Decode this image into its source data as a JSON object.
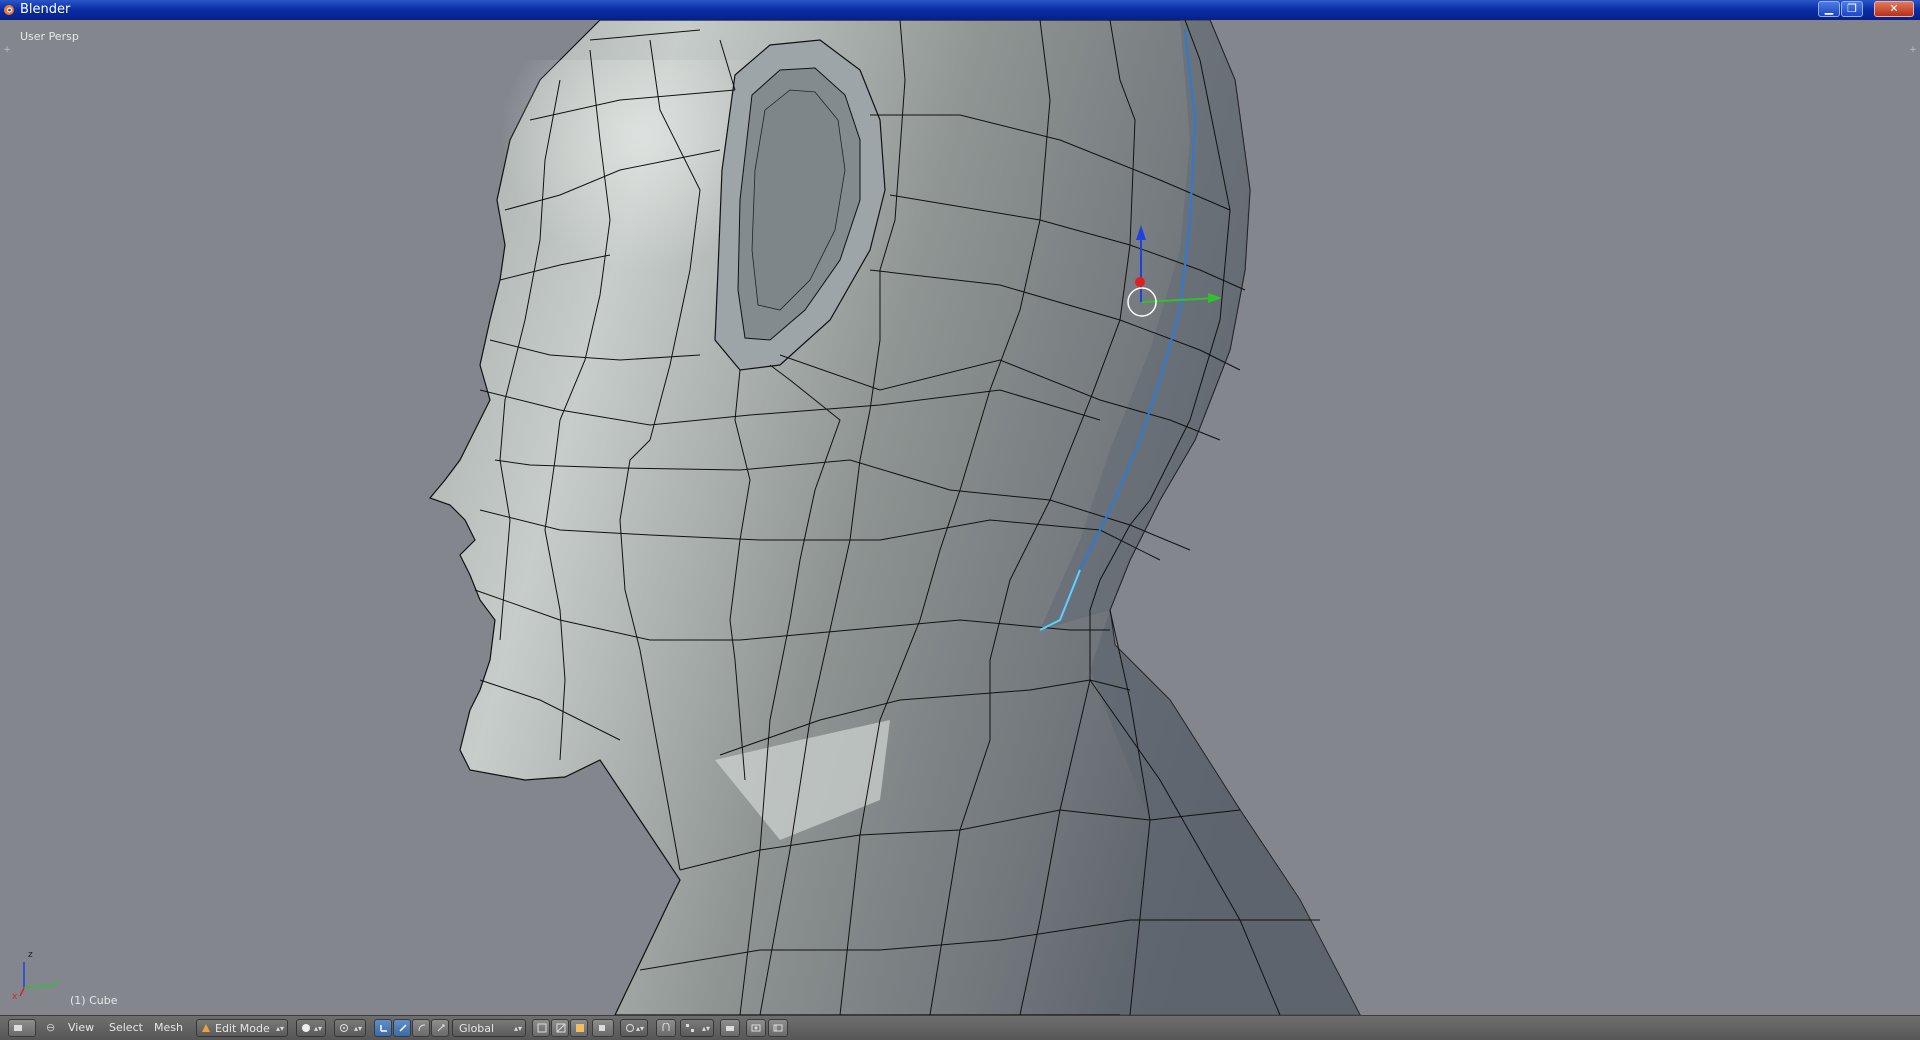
{
  "window": {
    "title": "Blender",
    "controls": {
      "minimize": "▁",
      "maximize": "❐",
      "close": "✕"
    }
  },
  "viewport": {
    "view_label": "User Persp",
    "object_label": "(1) Cube",
    "axis_labels": {
      "x": "x",
      "y": "y",
      "z": "z"
    }
  },
  "header": {
    "menus": [
      "View",
      "Select",
      "Mesh"
    ],
    "mode": "Edit Mode",
    "orientation": "Global"
  },
  "colors": {
    "accent": "#3d6aa6",
    "titlebar": "#0a2fa8",
    "background": "#83868d",
    "edge_selected": "#3ab0e8",
    "gizmo_x": "#e02020",
    "gizmo_y": "#30c030",
    "gizmo_z": "#2040e0"
  },
  "icons": [
    "blender-logo-icon",
    "editor-type-icon",
    "mode-icon",
    "shading-icon",
    "pivot-icon",
    "manipulator-icon",
    "select-mode-icon",
    "proportional-icon",
    "snap-icon",
    "render-icon"
  ]
}
